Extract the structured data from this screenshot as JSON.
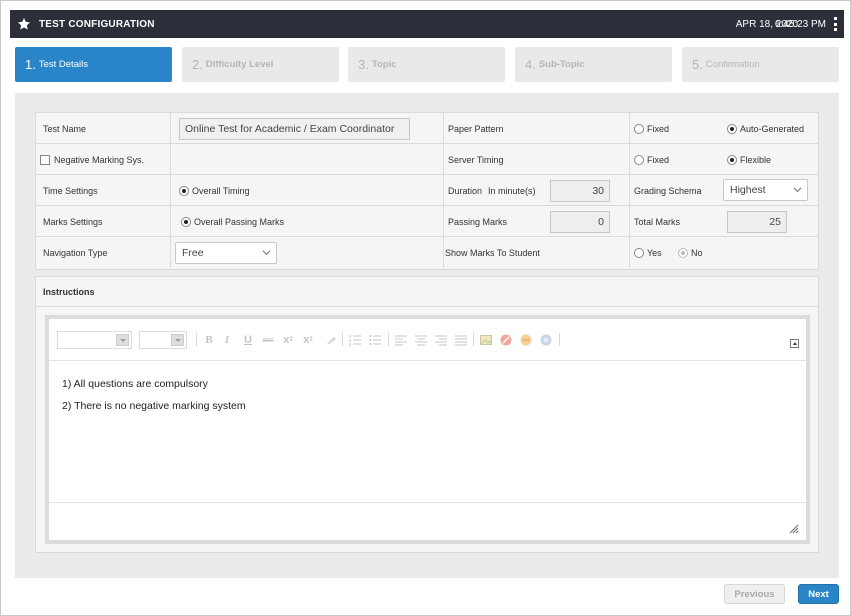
{
  "header": {
    "title": "TEST CONFIGURATION",
    "date": "APR 18, 2020",
    "time": "6:45:23 PM"
  },
  "steps": [
    {
      "num": "1.",
      "label": "Test Details",
      "active": true
    },
    {
      "num": "2.",
      "label": "Difficulty Level",
      "active": false
    },
    {
      "num": "3.",
      "label": "Topic",
      "active": false
    },
    {
      "num": "4.",
      "label": "Sub-Topic",
      "active": false
    },
    {
      "num": "5.",
      "label": "Confirmation",
      "active": false
    }
  ],
  "form": {
    "test_name_label": "Test Name",
    "test_name_value": "Online Test for Academic / Exam Coordinator",
    "paper_pattern_label": "Paper Pattern",
    "paper_pattern_fixed": "Fixed",
    "paper_pattern_auto": "Auto-Generated",
    "paper_pattern_selected": "Auto-Generated",
    "negative_marking_label": "Negative Marking Sys.",
    "negative_marking_checked": false,
    "server_timing_label": "Server Timing",
    "server_timing_fixed": "Fixed",
    "server_timing_flexible": "Flexible",
    "server_timing_selected": "Flexible",
    "time_settings_label": "Time Settings",
    "time_settings_option": "Overall Timing",
    "duration_label": "Duration",
    "duration_unit": "In minute(s)",
    "duration_value": "30",
    "grading_schema_label": "Grading Schema",
    "grading_schema_value": "Highest",
    "marks_settings_label": "Marks Settings",
    "marks_settings_option": "Overall Passing Marks",
    "passing_marks_label": "Passing Marks",
    "passing_marks_value": "0",
    "total_marks_label": "Total Marks",
    "total_marks_value": "25",
    "navigation_type_label": "Navigation Type",
    "navigation_type_value": "Free",
    "show_marks_label": "Show Marks To Student",
    "show_marks_yes": "Yes",
    "show_marks_no": "No",
    "show_marks_selected": "No"
  },
  "instructions": {
    "title": "Instructions",
    "lines": [
      "1) All questions are compulsory",
      "2) There is no negative marking system"
    ],
    "toolbar_icons": [
      "bold-icon",
      "italic-icon",
      "underline-icon",
      "strikethrough-icon",
      "subscript-icon",
      "superscript-icon",
      "eraser-icon",
      "ordered-list-icon",
      "unordered-list-icon",
      "align-left-icon",
      "align-center-icon",
      "align-right-icon",
      "justify-icon",
      "image-icon",
      "unlink-icon",
      "emoticon-icon",
      "globe-icon"
    ]
  },
  "footer": {
    "previous_label": "Previous",
    "next_label": "Next"
  },
  "colors": {
    "header_bg": "#2c2f3a",
    "accent": "#2a85c8",
    "panel_bg": "#ebebeb"
  }
}
